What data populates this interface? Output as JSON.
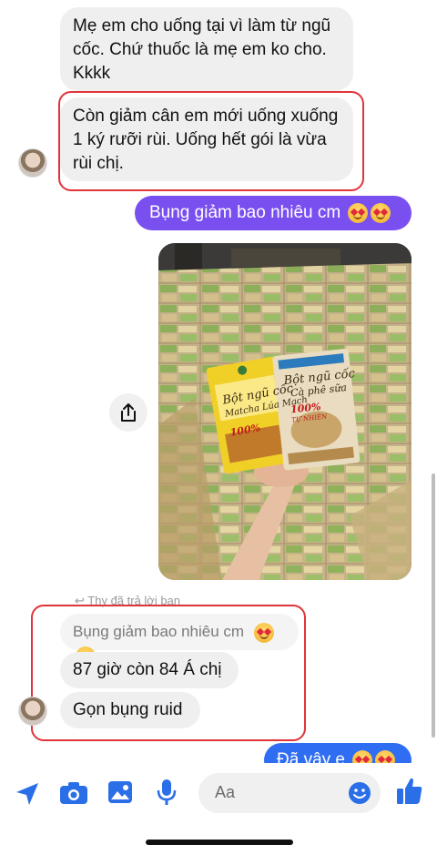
{
  "messages": {
    "m1_lines": [
      "Mẹ em cho uống tại vì làm từ ngũ",
      "cốc. Chứ thuốc là mẹ em ko cho.",
      "Kkkk"
    ],
    "m2_lines": [
      "Còn giảm cân em mới uống xuống",
      "1 ký rưỡi rùi. Uống hết gói là vừa",
      "rùi chị."
    ],
    "out1": "Bụng giảm bao nhiêu cm",
    "reply_note": "Thy đã trả lời bạn",
    "quoted": "Bụng giảm bao nhiêu cm",
    "m3": "87 giờ còn 84 Á chị",
    "m4": "Gọn bụng ruid",
    "out2": "Đã vậy e"
  },
  "photo": {
    "pack1_lines": [
      "Bột ngũ cốc",
      "Matcha Lúa Mạch",
      "100%"
    ],
    "pack2_lines": [
      "Bột ngũ cốc",
      "Cà phê sữa",
      "100%",
      "TỰ NHIÊN"
    ]
  },
  "composer": {
    "placeholder": "Aa"
  },
  "icons": {
    "share": "share-icon",
    "location": "location-arrow-icon",
    "camera": "camera-icon",
    "gallery": "image-icon",
    "mic": "microphone-icon",
    "emoji": "emoji-icon",
    "like": "thumbs-up-icon"
  },
  "colors": {
    "outgoing": "#7a4ff0",
    "outgoing_blue": "#2f6df2",
    "incoming": "#efefef",
    "highlight": "#e0343a",
    "accent": "#2a6ee8"
  }
}
